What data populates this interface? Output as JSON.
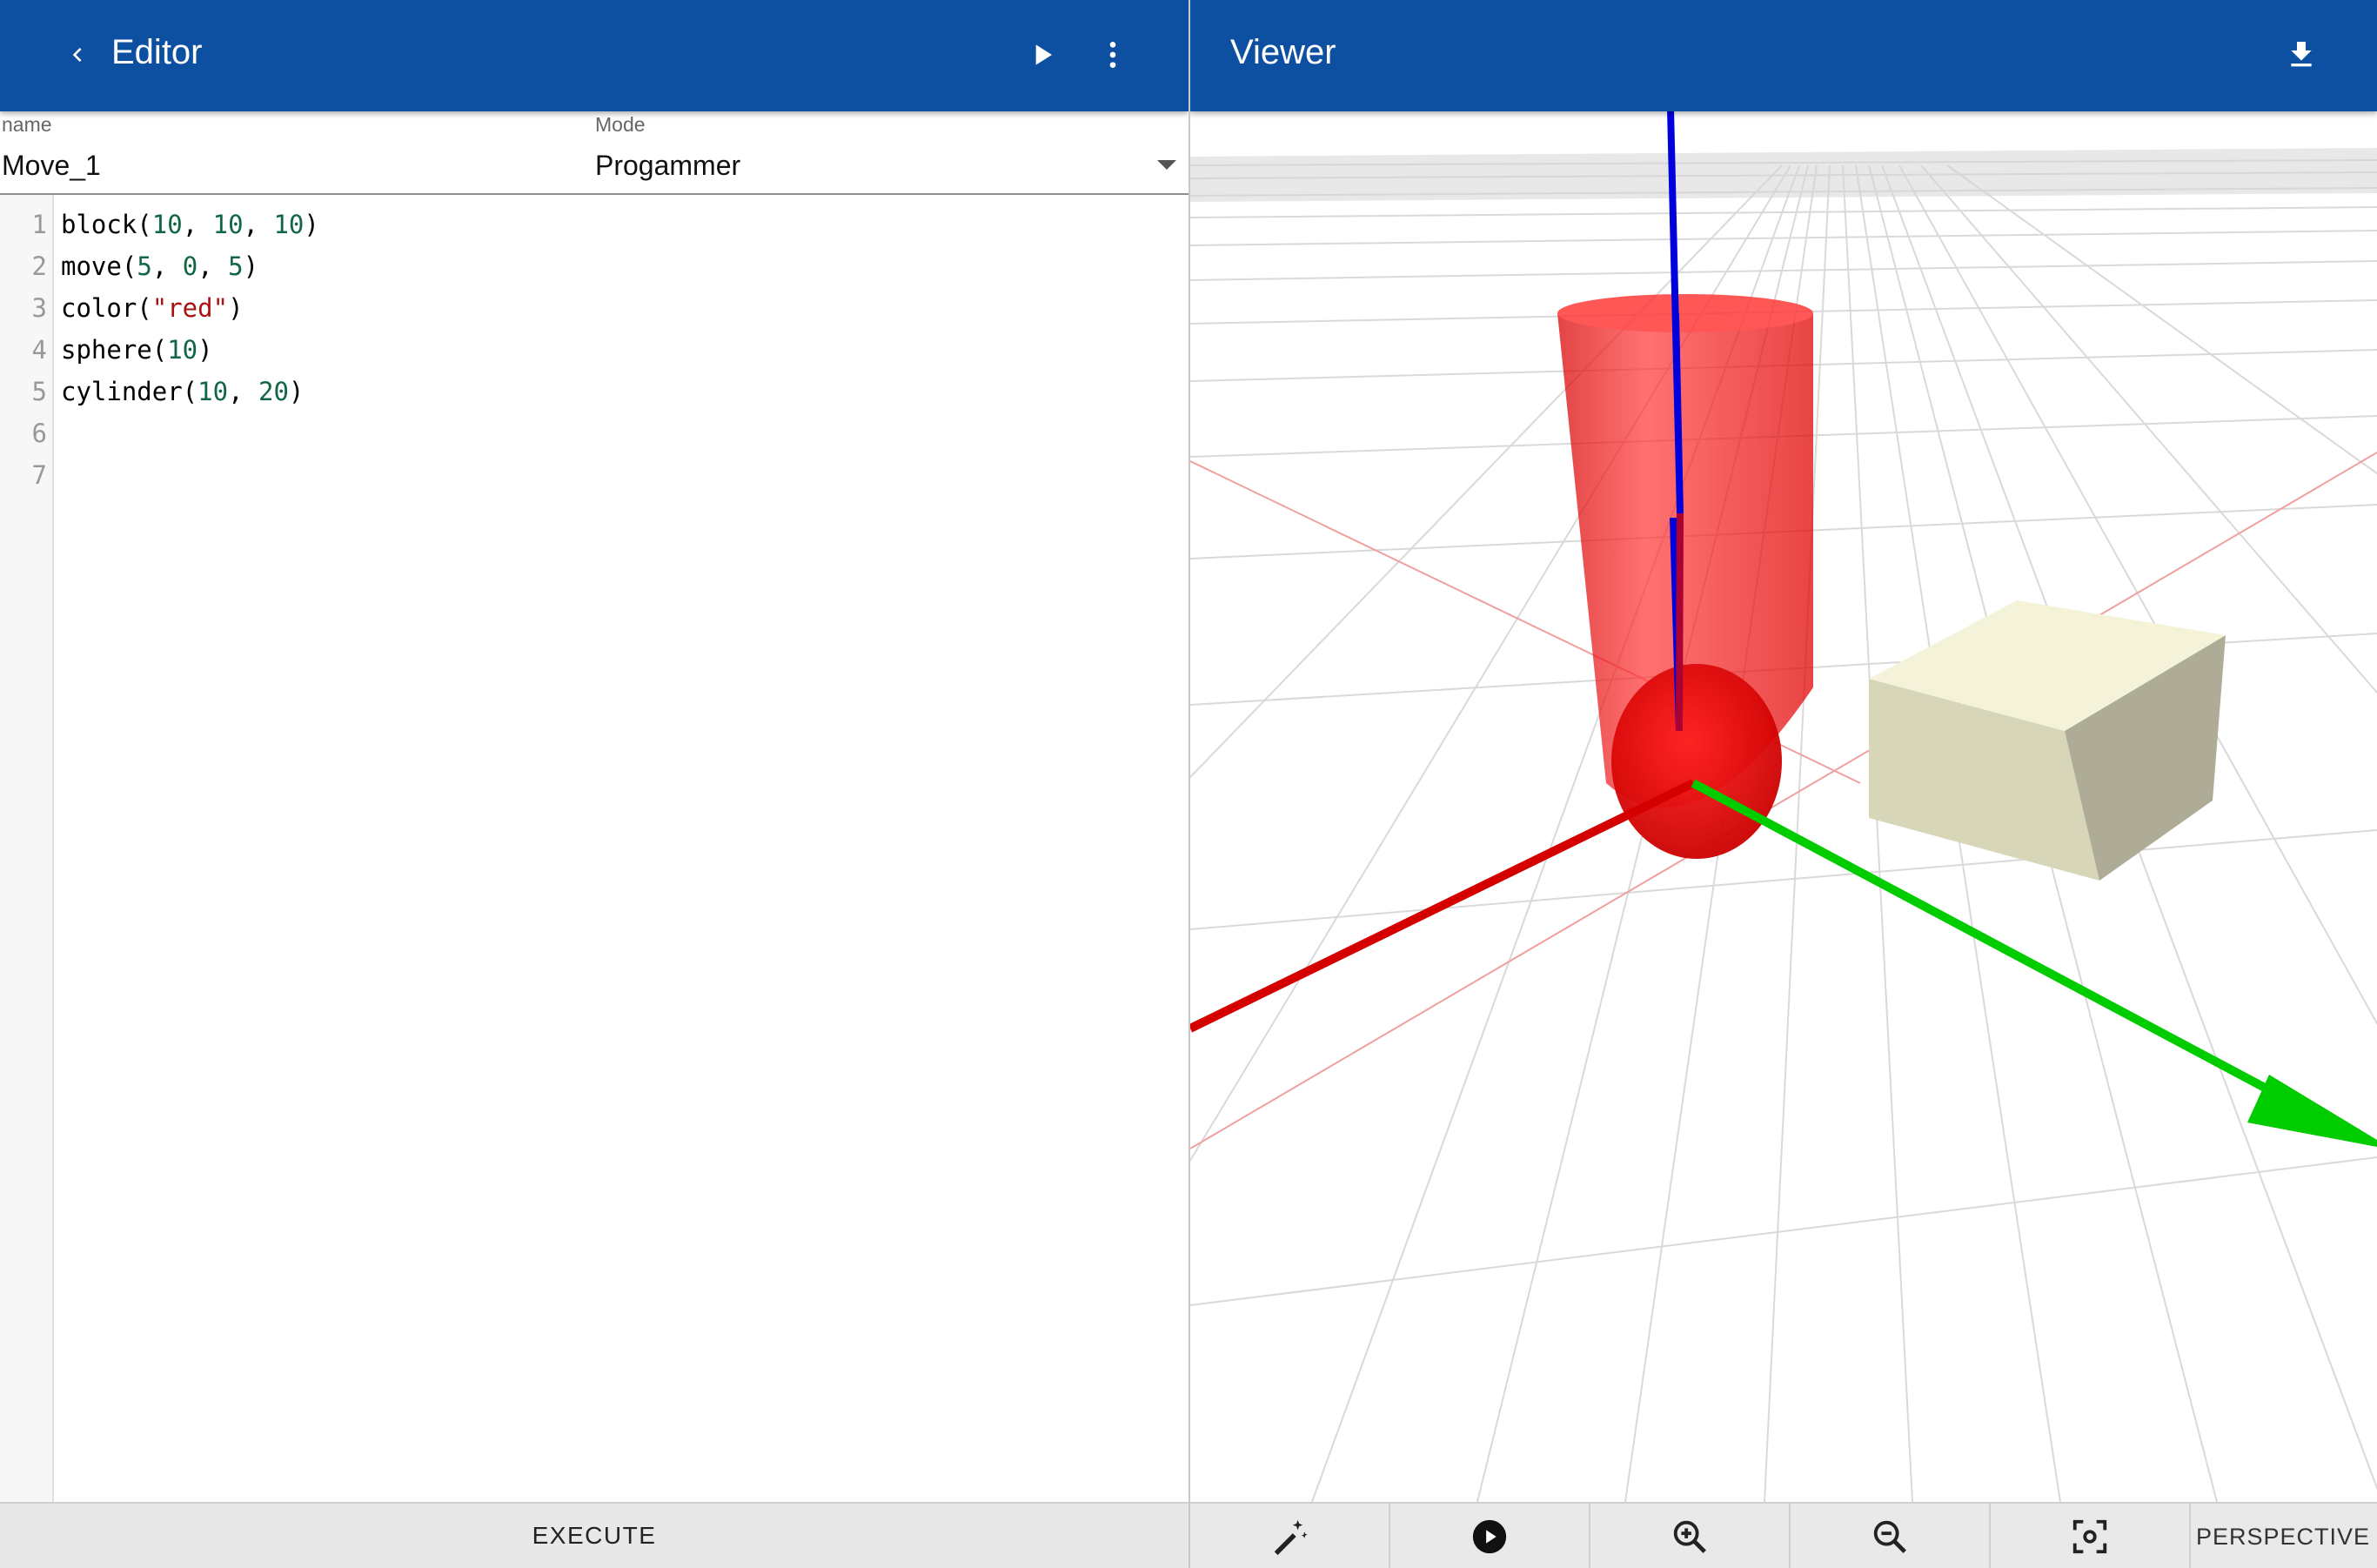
{
  "editor": {
    "title": "Editor",
    "name_label": "name",
    "name_value": "Move_1",
    "mode_label": "Mode",
    "mode_value": "Progammer",
    "execute_label": "EXECUTE",
    "line_numbers": [
      "1",
      "2",
      "3",
      "4",
      "5",
      "6",
      "7"
    ],
    "code": {
      "l1": {
        "fn": "block(",
        "a1": "10",
        "s1": ", ",
        "a2": "10",
        "s2": ", ",
        "a3": "10",
        "end": ")"
      },
      "l2": {
        "fn": "move(",
        "a1": "5",
        "s1": ", ",
        "a2": "0",
        "s2": ", ",
        "a3": "5",
        "end": ")"
      },
      "l3": {
        "fn": "color(",
        "str": "\"red\"",
        "end": ")"
      },
      "l4": {
        "fn": "sphere(",
        "a1": "10",
        "end": ")"
      },
      "l5": {
        "fn": "cylinder(",
        "a1": "10",
        "s1": ", ",
        "a2": "20",
        "end": ")"
      }
    }
  },
  "viewer": {
    "title": "Viewer",
    "projection_label": "PERSPECTIVE"
  },
  "icons": {
    "back": "chevron-left-icon",
    "run": "play-icon",
    "menu": "more-vert-icon",
    "download": "download-icon",
    "wand": "magic-wand-icon",
    "animate": "play-circle-icon",
    "zoom_in": "zoom-in-icon",
    "zoom_out": "zoom-out-icon",
    "fit": "center-focus-icon"
  },
  "colors": {
    "appbar": "#0d4fa0",
    "x_axis": "#d40000",
    "y_axis": "#00cc00",
    "z_axis": "#0000dd",
    "object_red": "#ff1a1a",
    "block": "#e8e6c8"
  }
}
